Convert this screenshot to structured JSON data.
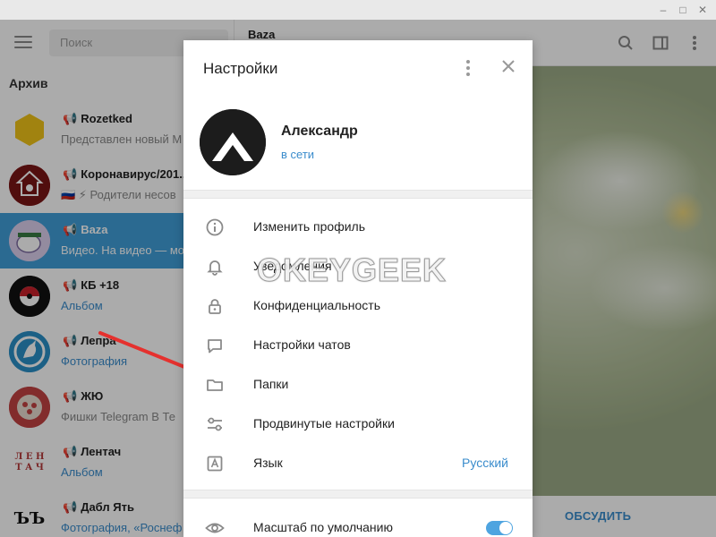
{
  "window": {
    "minimize": "–",
    "maximize": "□",
    "close": "✕"
  },
  "sidebar": {
    "search_placeholder": "Поиск",
    "archive_label": "Архив",
    "chats": [
      {
        "name": "Rozetked",
        "preview": "Представлен новый М",
        "megaphone": "📢",
        "avatar_color": "#f0c419"
      },
      {
        "name": "Коронавирус/201...",
        "preview": "🇷🇺 ⚡ Родители несов",
        "megaphone": "📢",
        "avatar_color": "#8b1a1a"
      },
      {
        "name": "Baza",
        "preview": "Видео. На видео — мо",
        "megaphone": "📢",
        "avatar_color": "#c9b7e0"
      },
      {
        "name": "КБ +18",
        "preview": "Альбом",
        "megaphone": "📢",
        "avatar_color": "#111111"
      },
      {
        "name": "Лепра",
        "preview": "Фотография",
        "megaphone": "📢",
        "avatar_color": "#2a8fc7"
      },
      {
        "name": "ЖЮ",
        "preview": "Фишки Telegram  В Те",
        "megaphone": "📢",
        "avatar_color": "#b5393a"
      },
      {
        "name": "Лентач",
        "preview": "Альбом",
        "megaphone": "📢",
        "avatar_color": "#ffffff",
        "avatar_text": "Л Е Н Т А Ч"
      },
      {
        "name": "Дабл Ять",
        "preview": "Фотография, «Роснеф",
        "megaphone": "📢",
        "avatar_color": "#ffffff",
        "avatar_text": "ЪЪ"
      }
    ]
  },
  "main": {
    "title": "Baza",
    "discuss_button": "ОБСУДИТЬ",
    "icons": [
      "search-icon",
      "sidebar-toggle-icon",
      "more-icon"
    ]
  },
  "dialog": {
    "title": "Настройки",
    "profile": {
      "name": "Александр",
      "status": "в сети"
    },
    "menu": [
      {
        "label": "Изменить профиль",
        "icon": "info-icon"
      },
      {
        "label": "Уведомления",
        "icon": "bell-icon"
      },
      {
        "label": "Конфиденциальность",
        "icon": "lock-icon"
      },
      {
        "label": "Настройки чатов",
        "icon": "chat-bubble-icon"
      },
      {
        "label": "Папки",
        "icon": "folder-icon"
      },
      {
        "label": "Продвинутые настройки",
        "icon": "sliders-icon"
      },
      {
        "label": "Язык",
        "icon": "language-icon",
        "value": "Русский"
      }
    ],
    "scale": {
      "label": "Масштаб по умолчанию",
      "icon": "eye-icon",
      "enabled": true
    }
  },
  "watermark": "OKEYGEEK",
  "colors": {
    "accent": "#419fd9",
    "link": "#3a8ccc",
    "arrow": "#e5312e"
  }
}
